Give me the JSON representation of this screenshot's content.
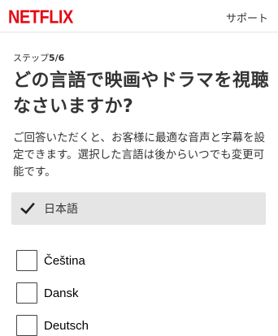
{
  "header": {
    "logo": "NETFLIX",
    "support_label": "サポート"
  },
  "step": {
    "prefix": "ステップ",
    "current": "5/6"
  },
  "title": "どの言語で映画やドラマを視聴なさいますか?",
  "description": "ご回答いただくと、お客様に最適な音声と字幕を設定できます。選択した言語は後からいつでも変更可能です。",
  "selected_language": {
    "label": "日本語",
    "icon": "checkmark-icon"
  },
  "languages": [
    {
      "label": "Čeština",
      "checked": false
    },
    {
      "label": "Dansk",
      "checked": false
    },
    {
      "label": "Deutsch",
      "checked": false
    }
  ],
  "colors": {
    "brand": "#e50914",
    "selected_bg": "#e5e5e5"
  }
}
